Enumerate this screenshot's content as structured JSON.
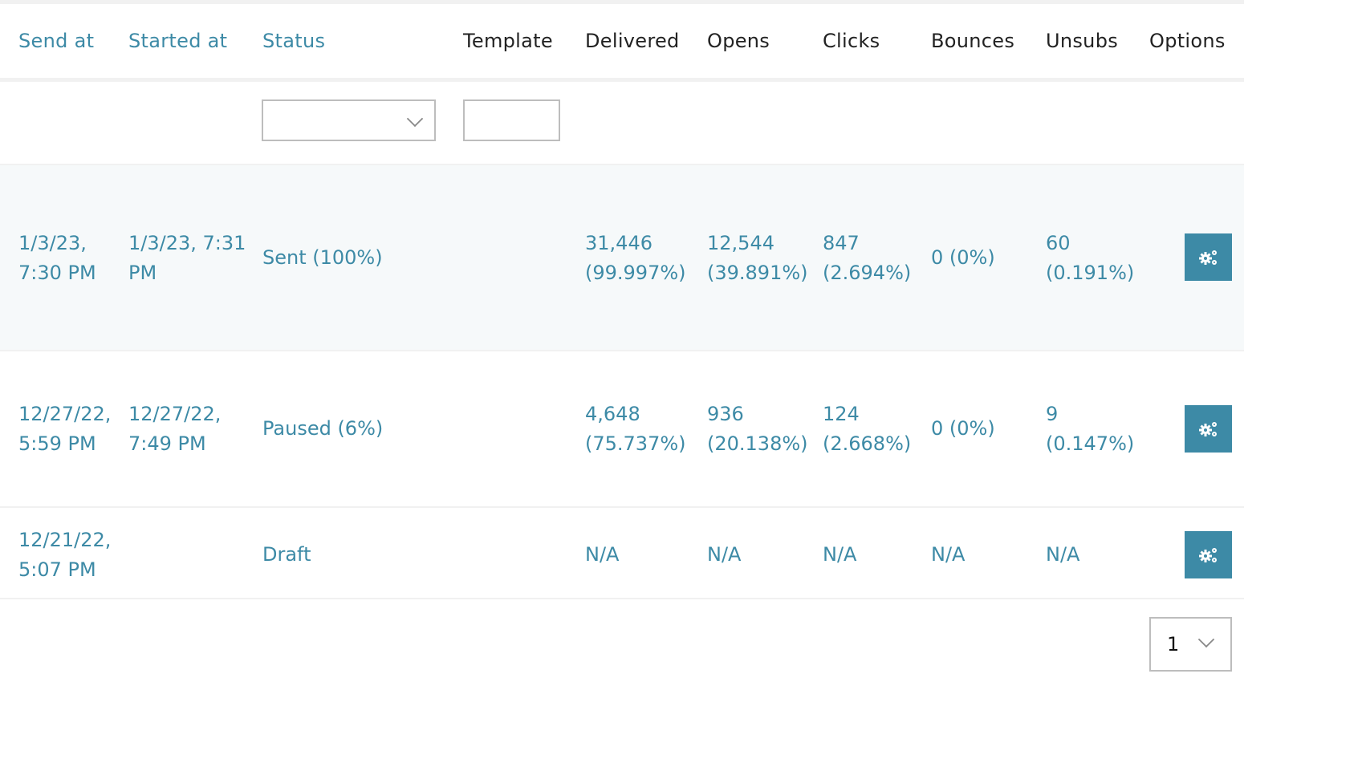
{
  "header": {
    "send_at": "Send at",
    "started_at": "Started at",
    "status": "Status",
    "template": "Template",
    "delivered": "Delivered",
    "opens": "Opens",
    "clicks": "Clicks",
    "bounces": "Bounces",
    "unsubs": "Unsubs",
    "options": "Options"
  },
  "filters": {
    "status_select_value": "",
    "template_input_value": ""
  },
  "rows": [
    {
      "send_at": [
        "1/3/23,",
        "7:30 PM"
      ],
      "started_at": [
        "1/3/23, 7:31",
        "PM"
      ],
      "status": "Sent (100%)",
      "delivered": [
        "31,446",
        "(99.997%)"
      ],
      "opens": [
        "12,544",
        "(39.891%)"
      ],
      "clicks": [
        "847",
        "(2.694%)"
      ],
      "bounces": "0 (0%)",
      "unsubs": [
        "60",
        "(0.191%)"
      ],
      "options_icon": "gears-icon"
    },
    {
      "send_at": [
        "12/27/22,",
        "5:59 PM"
      ],
      "started_at": [
        "12/27/22,",
        "7:49 PM"
      ],
      "status": "Paused (6%)",
      "delivered": [
        "4,648",
        "(75.737%)"
      ],
      "opens": [
        "936",
        "(20.138%)"
      ],
      "clicks": [
        "124",
        "(2.668%)"
      ],
      "bounces": "0 (0%)",
      "unsubs": [
        "9",
        "(0.147%)"
      ],
      "options_icon": "gears-icon"
    },
    {
      "send_at": [
        "12/21/22,",
        "5:07 PM"
      ],
      "started_at": [
        "",
        ""
      ],
      "status": "Draft",
      "delivered": "N/A",
      "opens": "N/A",
      "clicks": "N/A",
      "bounces": "N/A",
      "unsubs": "N/A",
      "options_icon": "gears-icon"
    }
  ],
  "pagination": {
    "per_page_value": "1"
  },
  "colors": {
    "accent": "#3d8aa6",
    "row_alt_bg": "#f6f9fa",
    "divider": "#f1f1f1"
  }
}
